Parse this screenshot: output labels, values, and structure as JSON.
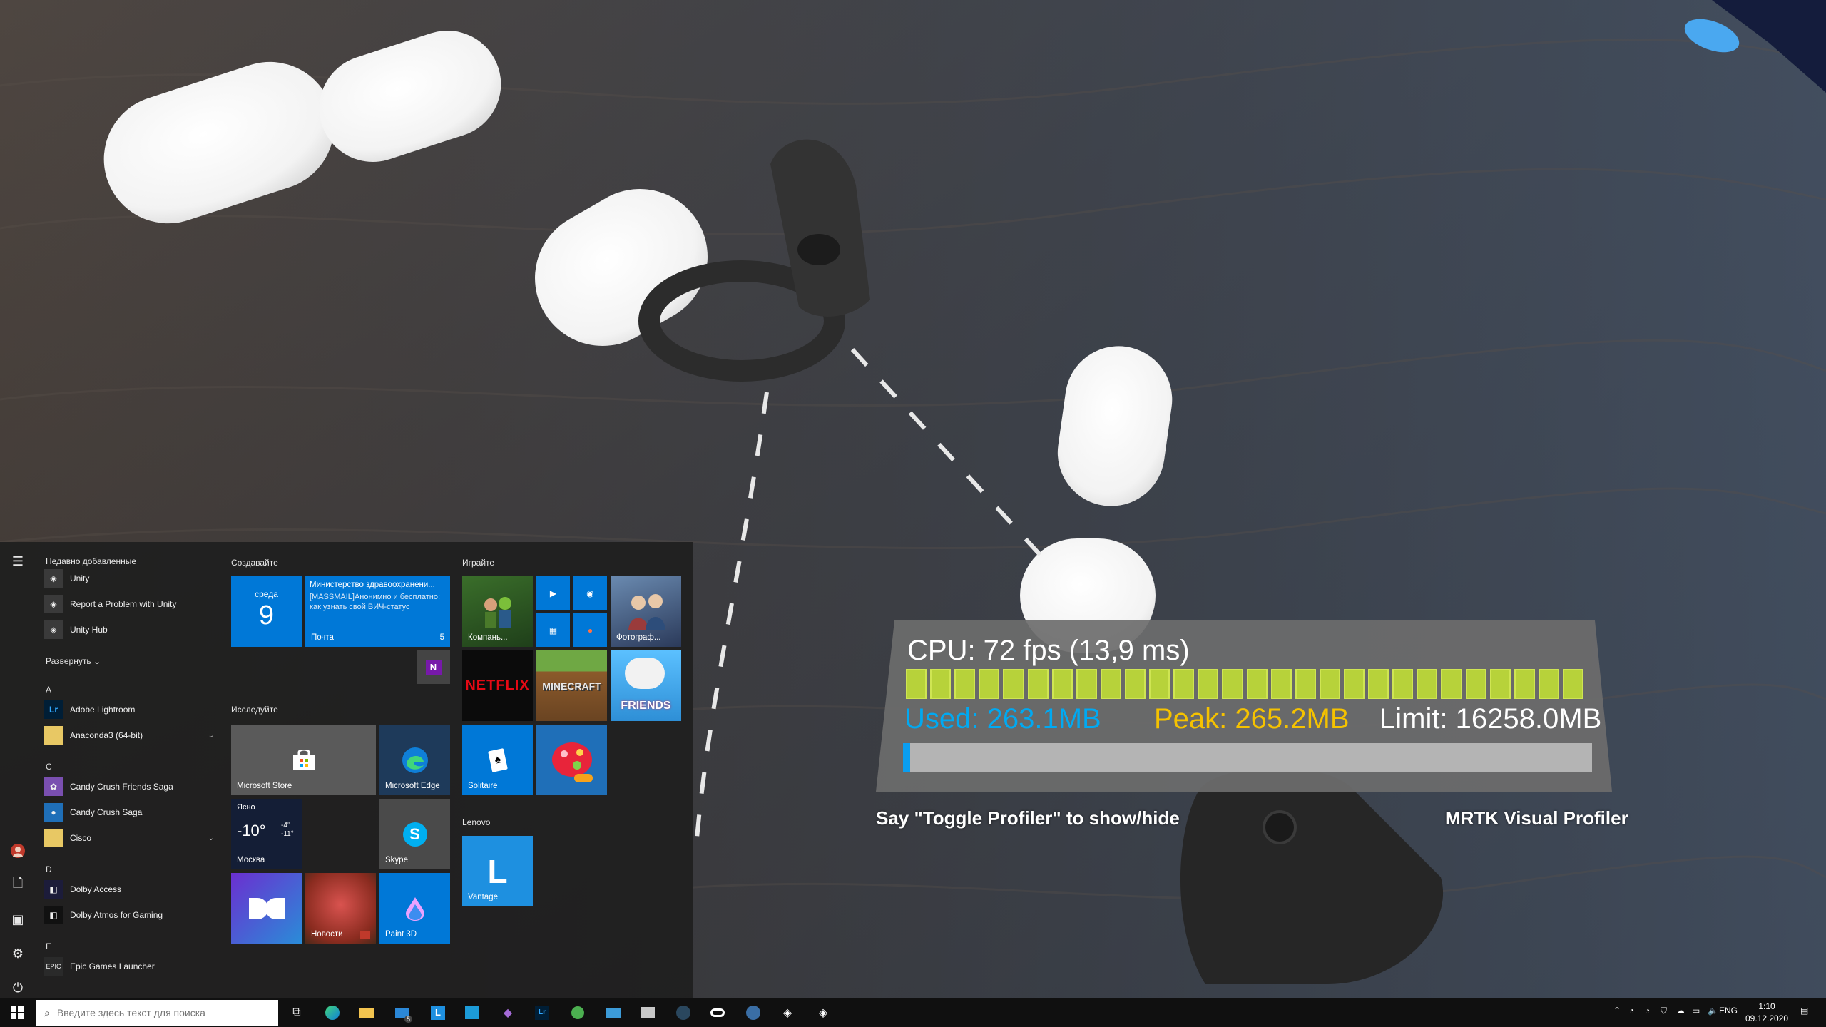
{
  "profiler": {
    "cpu_label": "CPU: 72 fps (13,9 ms)",
    "fps_bar_count": 28,
    "used_label": "Used: 263.1MB",
    "peak_label": "Peak: 265.2MB",
    "limit_label": "Limit: 16258.0MB",
    "memory_used_fraction": 0.01,
    "hint": "Say \"Toggle Profiler\" to show/hide",
    "title": "MRTK Visual Profiler",
    "colors": {
      "fps_bar": "#b7d23a",
      "used": "#00a9f2",
      "peak": "#f5c200"
    }
  },
  "start_menu": {
    "recent_header": "Недавно добавленные",
    "recent": [
      {
        "label": "Unity",
        "icon": "unity-icon"
      },
      {
        "label": "Report a Problem with Unity",
        "icon": "unity-icon"
      },
      {
        "label": "Unity Hub",
        "icon": "unity-hub-icon"
      }
    ],
    "expand_label": "Развернуть",
    "letter_a": "A",
    "letter_c": "C",
    "letter_d": "D",
    "letter_e": "E",
    "apps_a": [
      {
        "label": "Adobe Lightroom",
        "icon": "lightroom-icon"
      },
      {
        "label": "Anaconda3 (64-bit)",
        "icon": "folder-icon"
      }
    ],
    "apps_c": [
      {
        "label": "Candy Crush Friends Saga",
        "icon": "candy-friends-icon"
      },
      {
        "label": "Candy Crush Saga",
        "icon": "candy-crush-icon"
      },
      {
        "label": "Cisco",
        "icon": "folder-icon"
      }
    ],
    "apps_d": [
      {
        "label": "Dolby Access",
        "icon": "dolby-icon"
      },
      {
        "label": "Dolby Atmos for Gaming",
        "icon": "dolby-icon"
      }
    ],
    "apps_e": [
      {
        "label": "Epic Games Launcher",
        "icon": "epic-icon"
      }
    ],
    "groups": {
      "create": "Создавайте",
      "explore": "Исследуйте",
      "play": "Играйте",
      "lenovo": "Lenovo"
    },
    "tiles": {
      "calendar_day": "среда",
      "calendar_date": "9",
      "mail_subject": "Министерство здравоохранени...",
      "mail_body": "[MASSMAIL]Анонимно и бесплатно: как узнать свой ВИЧ-статус",
      "mail_label": "Почта",
      "mail_count": "5",
      "store": "Microsoft Store",
      "edge": "Microsoft Edge",
      "weather_cond": "Ясно",
      "weather_temp": "-10°",
      "weather_high": "-4°",
      "weather_low": "-11°",
      "weather_city": "Москва",
      "skype": "Skype",
      "news": "Новости",
      "paint3d": "Paint 3D",
      "companions": "Компань...",
      "photos": "Фотограф...",
      "netflix": "NETFLIX",
      "minecraft": "MINECRAFT",
      "friends": "FRIENDS",
      "solitaire": "Solitaire",
      "vantage": "Vantage"
    }
  },
  "taskbar": {
    "search_placeholder": "Введите здесь текст для поиска",
    "mail_badge": "5",
    "language": "ENG",
    "time": "1:10",
    "date": "09.12.2020"
  }
}
